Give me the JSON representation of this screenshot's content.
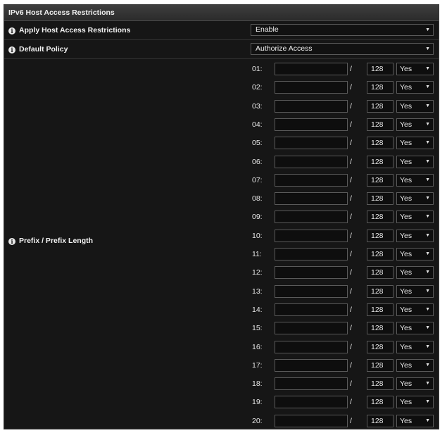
{
  "section": {
    "title": "IPv6 Host Access Restrictions"
  },
  "apply": {
    "label": "Apply Host Access Restrictions",
    "value": "Enable"
  },
  "policy": {
    "label": "Default Policy",
    "value": "Authorize Access"
  },
  "prefix": {
    "label": "Prefix / Prefix Length",
    "separator": "/"
  },
  "icons": {
    "info": "info-icon",
    "dropdown": "chevron-down-icon"
  },
  "entries": [
    {
      "num": "01:",
      "prefix": "",
      "length": "128",
      "enabled": "Yes"
    },
    {
      "num": "02:",
      "prefix": "",
      "length": "128",
      "enabled": "Yes"
    },
    {
      "num": "03:",
      "prefix": "",
      "length": "128",
      "enabled": "Yes"
    },
    {
      "num": "04:",
      "prefix": "",
      "length": "128",
      "enabled": "Yes"
    },
    {
      "num": "05:",
      "prefix": "",
      "length": "128",
      "enabled": "Yes"
    },
    {
      "num": "06:",
      "prefix": "",
      "length": "128",
      "enabled": "Yes"
    },
    {
      "num": "07:",
      "prefix": "",
      "length": "128",
      "enabled": "Yes"
    },
    {
      "num": "08:",
      "prefix": "",
      "length": "128",
      "enabled": "Yes"
    },
    {
      "num": "09:",
      "prefix": "",
      "length": "128",
      "enabled": "Yes"
    },
    {
      "num": "10:",
      "prefix": "",
      "length": "128",
      "enabled": "Yes"
    },
    {
      "num": "11:",
      "prefix": "",
      "length": "128",
      "enabled": "Yes"
    },
    {
      "num": "12:",
      "prefix": "",
      "length": "128",
      "enabled": "Yes"
    },
    {
      "num": "13:",
      "prefix": "",
      "length": "128",
      "enabled": "Yes"
    },
    {
      "num": "14:",
      "prefix": "",
      "length": "128",
      "enabled": "Yes"
    },
    {
      "num": "15:",
      "prefix": "",
      "length": "128",
      "enabled": "Yes"
    },
    {
      "num": "16:",
      "prefix": "",
      "length": "128",
      "enabled": "Yes"
    },
    {
      "num": "17:",
      "prefix": "",
      "length": "128",
      "enabled": "Yes"
    },
    {
      "num": "18:",
      "prefix": "",
      "length": "128",
      "enabled": "Yes"
    },
    {
      "num": "19:",
      "prefix": "",
      "length": "128",
      "enabled": "Yes"
    },
    {
      "num": "20:",
      "prefix": "",
      "length": "128",
      "enabled": "Yes"
    }
  ]
}
